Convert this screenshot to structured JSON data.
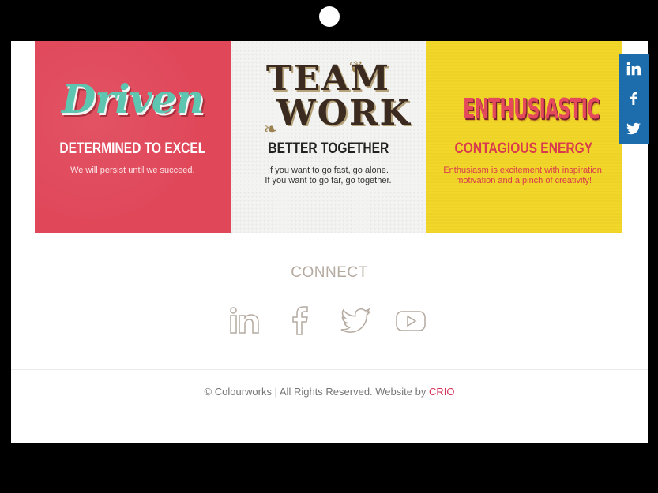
{
  "cards": [
    {
      "logo": "Driven",
      "subtitle": "DETERMINED TO EXCEL",
      "description": "We will persist until we succeed."
    },
    {
      "logo_line1": "TEAM",
      "logo_line2": "WORK",
      "subtitle": "BETTER TOGETHER",
      "description_line1": "If you want to go fast, go alone.",
      "description_line2": "If you want to go far, go together."
    },
    {
      "logo": "ENTHUSIASTIC",
      "subtitle": "CONTAGIOUS ENERGY",
      "description_line1": "Enthusiasm is excitement with inspiration,",
      "description_line2": "motivation and a pinch of creativity!"
    }
  ],
  "connect": {
    "heading": "CONNECT",
    "icons": [
      "linkedin-icon",
      "facebook-icon",
      "twitter-icon",
      "youtube-icon"
    ]
  },
  "footer": {
    "copyright": "© Colourworks",
    "separator": "|",
    "rights": "All Rights Reserved. Website by",
    "brand": "CRIO"
  },
  "share_bar": {
    "icons": [
      "linkedin-icon",
      "facebook-icon",
      "twitter-icon"
    ]
  },
  "colors": {
    "red_card": "#e0485a",
    "yellow_card": "#f2d629",
    "share_blue": "#1d6dad",
    "brand": "#d6335a",
    "muted": "#b4aaa0"
  }
}
